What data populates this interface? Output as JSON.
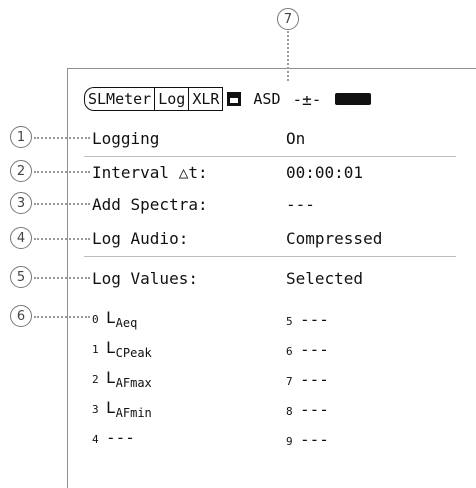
{
  "callouts": [
    "1",
    "2",
    "3",
    "4",
    "5",
    "6",
    "7"
  ],
  "header": {
    "tabs": [
      "SLMeter",
      "Log",
      "XLR"
    ],
    "save_icon": "floppy-icon",
    "mode": "ASD",
    "connection_icon": "plug-icon",
    "battery_icon": "battery-icon"
  },
  "settings": [
    {
      "label": "Logging",
      "value": "On"
    },
    {
      "label": "Interval △t:",
      "value": "00:00:01"
    },
    {
      "label": "Add Spectra:",
      "value": "---"
    },
    {
      "label": "Log Audio:",
      "value": "Compressed"
    },
    {
      "label": "Log Values:",
      "value": "Selected"
    }
  ],
  "log_values": {
    "left": [
      {
        "index": "0",
        "name": "L",
        "sub": "Aeq"
      },
      {
        "index": "1",
        "name": "L",
        "sub": "CPeak"
      },
      {
        "index": "2",
        "name": "L",
        "sub": "AFmax"
      },
      {
        "index": "3",
        "name": "L",
        "sub": "AFmin"
      },
      {
        "index": "4",
        "name": "---",
        "sub": ""
      }
    ],
    "right": [
      {
        "index": "5",
        "value": "---"
      },
      {
        "index": "6",
        "value": "---"
      },
      {
        "index": "7",
        "value": "---"
      },
      {
        "index": "8",
        "value": "---"
      },
      {
        "index": "9",
        "value": "---"
      }
    ]
  }
}
